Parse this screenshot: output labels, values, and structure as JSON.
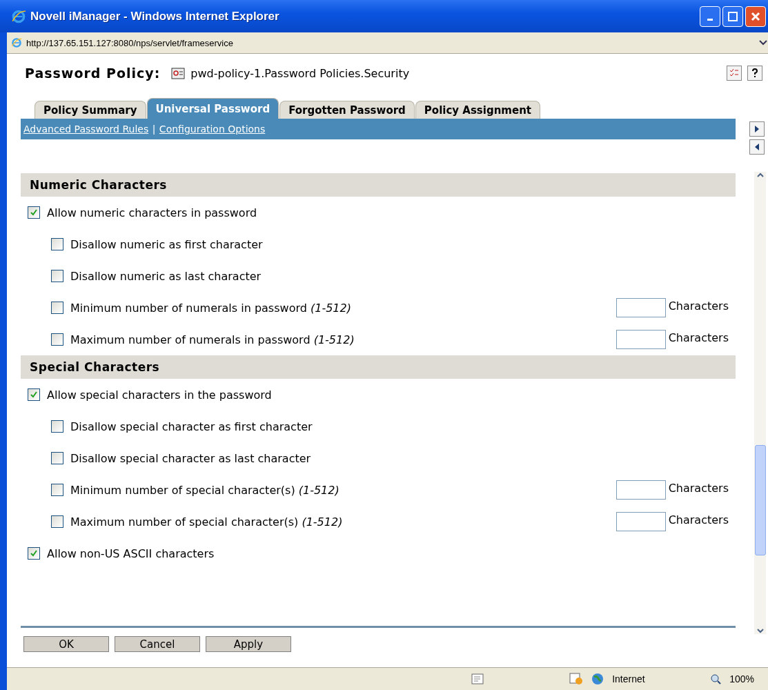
{
  "window": {
    "title": "Novell iManager - Windows Internet Explorer"
  },
  "address_bar": {
    "url": "http://137.65.151.127:8080/nps/servlet/frameservice"
  },
  "page_header": {
    "label": "Password Policy:",
    "object": "pwd-policy-1.Password Policies.Security"
  },
  "tabs": [
    {
      "label": "Policy Summary",
      "selected": false
    },
    {
      "label": "Universal Password",
      "selected": true
    },
    {
      "label": "Forgotten Password",
      "selected": false
    },
    {
      "label": "Policy Assignment",
      "selected": false
    }
  ],
  "subnav": {
    "links": [
      "Advanced Password Rules",
      "Configuration Options"
    ],
    "separator": "|"
  },
  "sections": [
    {
      "title": "Numeric Characters",
      "options": [
        {
          "kind": "checkbox",
          "label": "Allow numeric characters in password",
          "checked": true,
          "nested": false
        },
        {
          "kind": "checkbox",
          "label": "Disallow numeric as first character",
          "checked": false,
          "nested": true
        },
        {
          "kind": "checkbox",
          "label": "Disallow numeric as last character",
          "checked": false,
          "nested": true
        },
        {
          "kind": "count",
          "label": "Minimum number of numerals in password *(1-512)*",
          "checked": false,
          "nested": true,
          "unit": "Characters"
        },
        {
          "kind": "count",
          "label": "Maximum number of numerals in password *(1-512)*",
          "checked": false,
          "nested": true,
          "unit": "Characters"
        }
      ]
    },
    {
      "title": "Special Characters",
      "options": [
        {
          "kind": "checkbox",
          "label": "Allow special characters in the password",
          "checked": true,
          "nested": false
        },
        {
          "kind": "checkbox",
          "label": "Disallow special character as first character",
          "checked": false,
          "nested": true
        },
        {
          "kind": "checkbox",
          "label": "Disallow special character as last character",
          "checked": false,
          "nested": true
        },
        {
          "kind": "count",
          "label": "Minimum number of special character(s) *(1-512)*",
          "checked": false,
          "nested": true,
          "unit": "Characters"
        },
        {
          "kind": "count",
          "label": "Maximum number of special character(s) *(1-512)*",
          "checked": false,
          "nested": true,
          "unit": "Characters"
        },
        {
          "kind": "checkbox",
          "label": "Allow non-US ASCII characters",
          "checked": true,
          "nested": false
        }
      ]
    }
  ],
  "buttons": [
    "OK",
    "Cancel",
    "Apply"
  ],
  "status_bar": {
    "zone": "Internet",
    "zoom": "100%"
  }
}
